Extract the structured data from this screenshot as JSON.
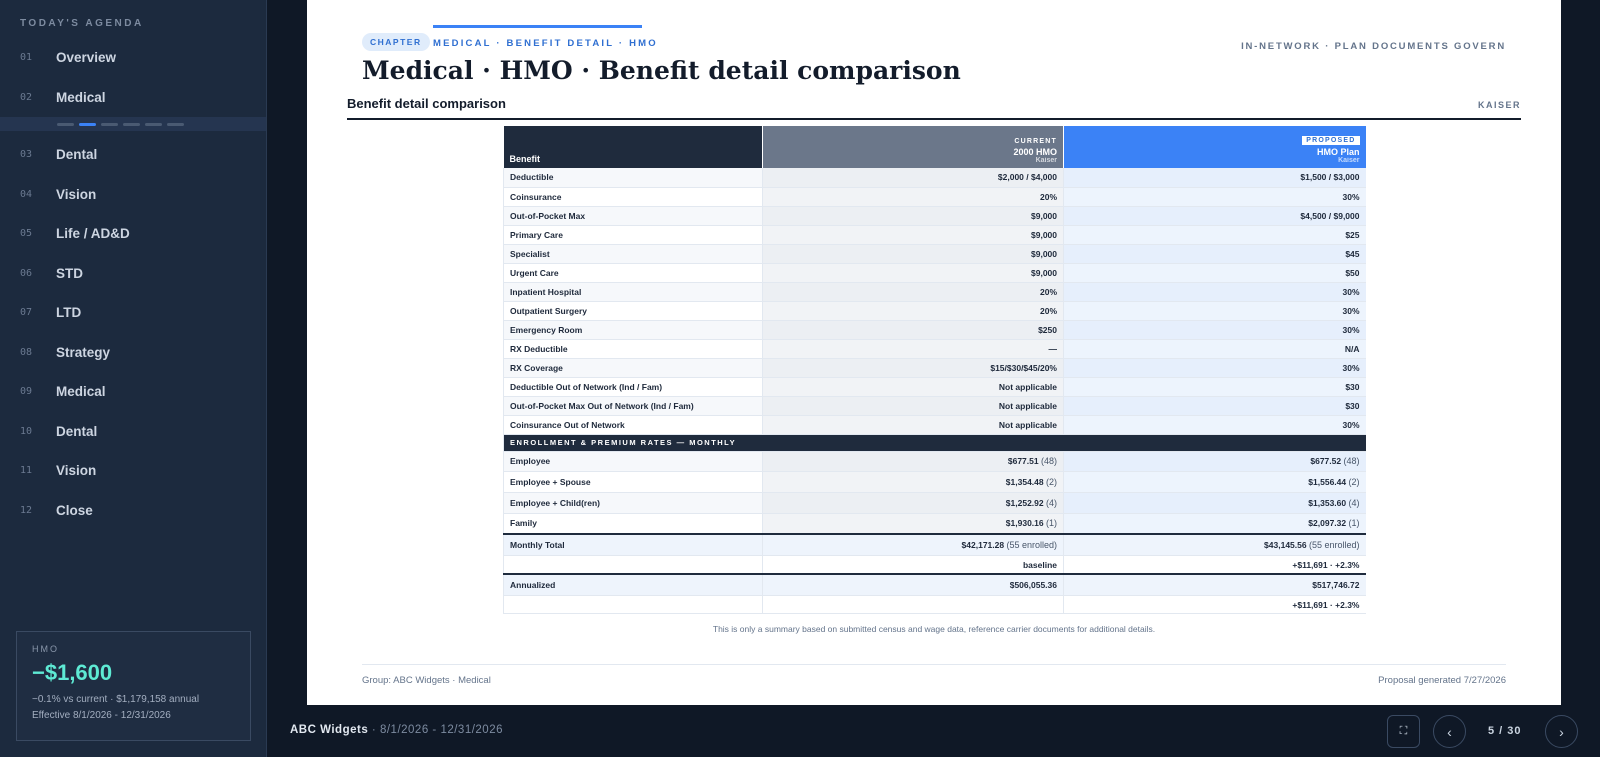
{
  "sidebar": {
    "title": "TODAY'S AGENDA",
    "items": [
      {
        "num": "01",
        "label": "Overview"
      },
      {
        "num": "02",
        "label": "Medical"
      },
      {
        "num": "03",
        "label": "Dental"
      },
      {
        "num": "04",
        "label": "Vision"
      },
      {
        "num": "05",
        "label": "Life / AD&D"
      },
      {
        "num": "06",
        "label": "STD"
      },
      {
        "num": "07",
        "label": "LTD"
      },
      {
        "num": "08",
        "label": "Strategy"
      },
      {
        "num": "09",
        "label": "Medical"
      },
      {
        "num": "10",
        "label": "Dental"
      },
      {
        "num": "11",
        "label": "Vision"
      },
      {
        "num": "12",
        "label": "Close"
      }
    ],
    "sub_progress": {
      "total": 6,
      "active_index": 1
    },
    "card": {
      "label": "HMO",
      "amount": "−$1,600",
      "line1": "−0.1% vs current · $1,179,158 annual",
      "line2": "Effective 8/1/2026 - 12/31/2026"
    }
  },
  "footer": {
    "company": "ABC Widgets",
    "dates": " · 8/1/2026 - 12/31/2026",
    "fullscreen_icon": "⛶",
    "prev_icon": "‹",
    "next_icon": "›",
    "pager": "5 / 30"
  },
  "slide": {
    "chapter": "CHAPTER",
    "crumb": "MEDICAL · BENEFIT DETAIL · HMO",
    "right_note": "IN-NETWORK · PLAN DOCUMENTS GOVERN",
    "title": "Medical · HMO · Benefit detail comparison",
    "section_title": "Benefit detail comparison",
    "carrier": "KAISER",
    "table": {
      "col_benefit": "Benefit",
      "current": {
        "tag": "CURRENT",
        "name": "2000 HMO",
        "carrier": "Kaiser"
      },
      "proposed": {
        "tag": "PROPOSED",
        "name": "HMO Plan",
        "carrier": "Kaiser"
      },
      "rows": [
        [
          "Deductible",
          "$2,000 / $4,000",
          "$1,500 / $3,000"
        ],
        [
          "Coinsurance",
          "20%",
          "30%"
        ],
        [
          "Out-of-Pocket Max",
          "$9,000",
          "$4,500 / $9,000"
        ],
        [
          "Primary Care",
          "$9,000",
          "$25"
        ],
        [
          "Specialist",
          "$9,000",
          "$45"
        ],
        [
          "Urgent Care",
          "$9,000",
          "$50"
        ],
        [
          "Inpatient Hospital",
          "20%",
          "30%"
        ],
        [
          "Outpatient Surgery",
          "20%",
          "30%"
        ],
        [
          "Emergency Room",
          "$250",
          "30%"
        ],
        [
          "RX Deductible",
          "—",
          "N/A"
        ],
        [
          "RX Coverage",
          "$15/$30/$45/20%",
          "30%"
        ],
        [
          "Deductible Out of Network (Ind / Fam)",
          "Not applicable",
          "$30"
        ],
        [
          "Out-of-Pocket Max Out of Network (Ind / Fam)",
          "Not applicable",
          "$30"
        ],
        [
          "Coinsurance Out of Network",
          "Not applicable",
          "30%"
        ]
      ],
      "section": "ENROLLMENT & PREMIUM RATES — MONTHLY",
      "rates": [
        {
          "tier": "Employee",
          "cur": "$677.51",
          "cur_n": "(48)",
          "pro": "$677.52",
          "pro_n": "(48)"
        },
        {
          "tier": "Employee + Spouse",
          "cur": "$1,354.48",
          "cur_n": "(2)",
          "pro": "$1,556.44",
          "pro_n": "(2)"
        },
        {
          "tier": "Employee + Child(ren)",
          "cur": "$1,252.92",
          "cur_n": "(4)",
          "pro": "$1,353.60",
          "pro_n": "(4)"
        },
        {
          "tier": "Family",
          "cur": "$1,930.16",
          "cur_n": "(1)",
          "pro": "$2,097.32",
          "pro_n": "(1)"
        }
      ],
      "monthly": {
        "label": "Monthly Total",
        "cur": "$42,171.28",
        "cur_n": "(55 enrolled)",
        "pro": "$43,145.56",
        "pro_n": "(55 enrolled)",
        "cur_delta": "baseline",
        "pro_delta": "+$11,691 · +2.3%"
      },
      "annual": {
        "label": "Annualized",
        "cur": "$506,055.36",
        "pro": "$517,746.72",
        "pro_delta": "+$11,691 · +2.3%"
      }
    },
    "disclaimer": "This is only a summary based on submitted census and wage data, reference carrier documents for additional details.",
    "group": "Group: ABC Widgets · Medical",
    "generated": "Proposal generated 7/27/2026"
  }
}
